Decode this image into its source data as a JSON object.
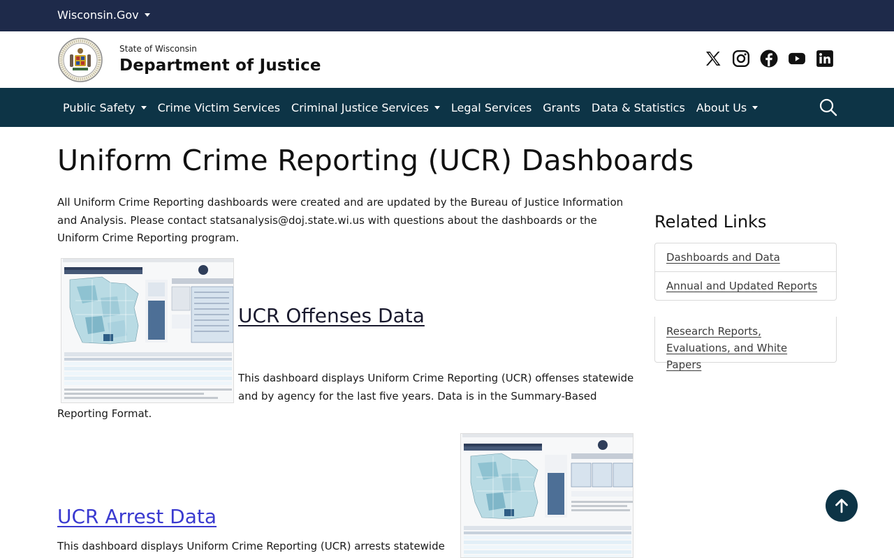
{
  "topbar": {
    "site_label": "Wisconsin.Gov"
  },
  "header": {
    "state_label": "State of Wisconsin",
    "dept_label": "Department of Justice",
    "social": [
      "x-icon",
      "instagram-icon",
      "facebook-icon",
      "youtube-icon",
      "linkedin-icon"
    ]
  },
  "nav": {
    "items": [
      {
        "label": "Public Safety",
        "dropdown": true
      },
      {
        "label": "Crime Victim Services",
        "dropdown": false
      },
      {
        "label": "Criminal Justice Services",
        "dropdown": true
      },
      {
        "label": "Legal Services",
        "dropdown": false
      },
      {
        "label": "Grants",
        "dropdown": false
      },
      {
        "label": "Data & Statistics",
        "dropdown": false
      },
      {
        "label": "About Us",
        "dropdown": true
      }
    ]
  },
  "page": {
    "title": "Uniform Crime Reporting (UCR) Dashboards",
    "intro": "All Uniform Crime Reporting dashboards were created and are updated by the Bureau of Justice Information and Analysis. Please contact statsanalysis@doj.state.wi.us with questions about the dashboards or the Uniform Crime Reporting program.",
    "dashboards": [
      {
        "title": "UCR Offenses Data",
        "desc_line1": "This dashboard displays Uniform Crime Reporting (UCR) offenses statewide and by agency for the last five years. Data is in the Summary-Based",
        "desc_line2": "Reporting Format."
      },
      {
        "title": "UCR Arrest Data",
        "desc": "This dashboard displays Uniform Crime Reporting (UCR) arrests statewide"
      }
    ]
  },
  "sidebar": {
    "title": "Related Links",
    "links": [
      "Dashboards and Data",
      "Annual and Updated Reports"
    ],
    "links2": [
      "Research Reports, Evaluations, and White Papers"
    ]
  },
  "colors": {
    "topbar": "#1e2a4a",
    "nav": "#0d3446",
    "link_visited": "#1a1a2e",
    "link": "#3a3ad0"
  }
}
